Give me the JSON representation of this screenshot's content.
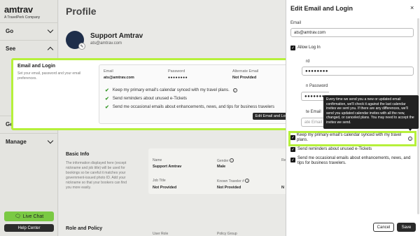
{
  "brand": {
    "name": "amtrav",
    "tagline": "A TravelPerk Company"
  },
  "sidebar": {
    "items": [
      {
        "label": "Go"
      },
      {
        "label": "See"
      },
      {
        "label": "Ge"
      },
      {
        "label": "Manage"
      }
    ],
    "live_chat": "Live Chat",
    "help_center": "Help Center"
  },
  "main": {
    "title": "Profile",
    "name": "Support Amtrav",
    "email": "ats@amtrav.com",
    "basic_info": {
      "title": "Basic Info",
      "description": "The information displayed here (except nickname and job title) will be used for bookings so be careful it matches your government-issued photo ID. Add your nickname so that your bookers can find you more easily.",
      "fields": [
        {
          "label": "Name",
          "value": "Support Amtrav"
        },
        {
          "label": "Gender",
          "value": "Male"
        },
        {
          "label": "Job Title",
          "value": "Not Provided"
        },
        {
          "label": "Known Traveler #",
          "value": "Not Provided"
        }
      ],
      "col_r_label": "Re",
      "col_r_value": "N"
    },
    "role_policy": {
      "title": "Role and Policy",
      "role_label": "User Role",
      "policy_label": "Policy Group"
    }
  },
  "email_card": {
    "title": "Email and Login",
    "description": "Set your email, password and your email preferences.",
    "email_label": "Email",
    "email_value": "ats@amtrav.com",
    "password_label": "Password",
    "password_value": "●●●●●●●●",
    "alt_email_label": "Alternate Email",
    "alt_email_value": "Not Provided",
    "prefs": [
      "Keep my primary email's calendar synced with my travel plans.",
      "Send reminders about unused e-Tickets",
      "Send me occasional emails about enhancements, news, and tips for business travelers"
    ],
    "edit_button": "Edit Email and Login"
  },
  "panel": {
    "title": "Edit Email and Login",
    "close": "×",
    "email_label": "Email",
    "email_value": "ats@amtrav.com",
    "allow_login": "Allow Log In",
    "password_label_partial": "rd",
    "password_value": "●●●●●●●●",
    "confirm_label_partial": "n Password",
    "confirm_value": "●●●●●●●●",
    "alt_label_partial": "te Email",
    "alt_placeholder_partial": "ate Email",
    "tooltip": "Every time we send you a new or updated email confirmation, we'll check it against the last calendar invites we sent you. If there are any differences, we'll send you updated calendar invites with all the new, changed, or canceled plans. You may need to accept the invites we send.",
    "pref_calendar": "Keep my primary email's calendar synced with my travel plans.",
    "pref_tickets": "Send reminders about unused e-Tickets",
    "pref_news": "Send me occasional emails about enhancements, news, and tips for business travelers.",
    "cancel": "Cancel",
    "save": "Save"
  }
}
